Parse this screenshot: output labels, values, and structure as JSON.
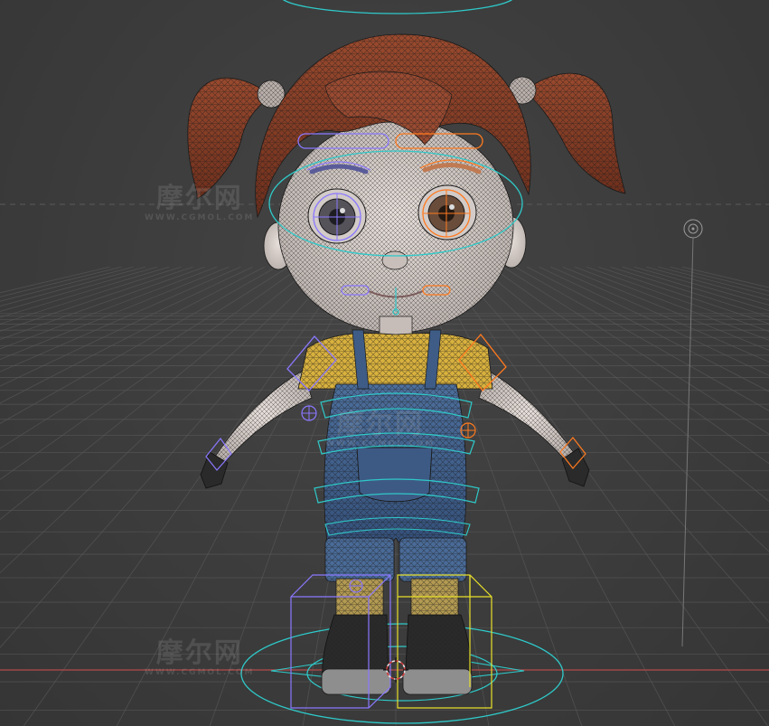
{
  "viewport": {
    "background": "#393939",
    "grid_color": "#5a5a5a",
    "axis_x_color": "#b54a4a"
  },
  "character": {
    "skin_color": "#d8cfcb",
    "hair_color": "#8b3f26",
    "shirt_color": "#d8b13e",
    "overalls_color": "#42628c",
    "boots_color": "#2a2a2a",
    "wire_color": "#1a1a1a"
  },
  "rig": {
    "controller_cyan": "#2fc9c9",
    "controller_left": "#8a78ff",
    "controller_right": "#ff7a1f",
    "controller_yellow": "#e8e02a"
  },
  "icons": {
    "empty_target": "crosshair-target-icon"
  },
  "watermarks": [
    {
      "main": "摩尔网",
      "sub": "WWW.CGMOL.COM"
    },
    {
      "main": "摩尔网",
      "sub": "WWW.CGMOL.COM"
    },
    {
      "main": "摩尔网",
      "sub": "WWW.CGMOL.COM"
    }
  ]
}
